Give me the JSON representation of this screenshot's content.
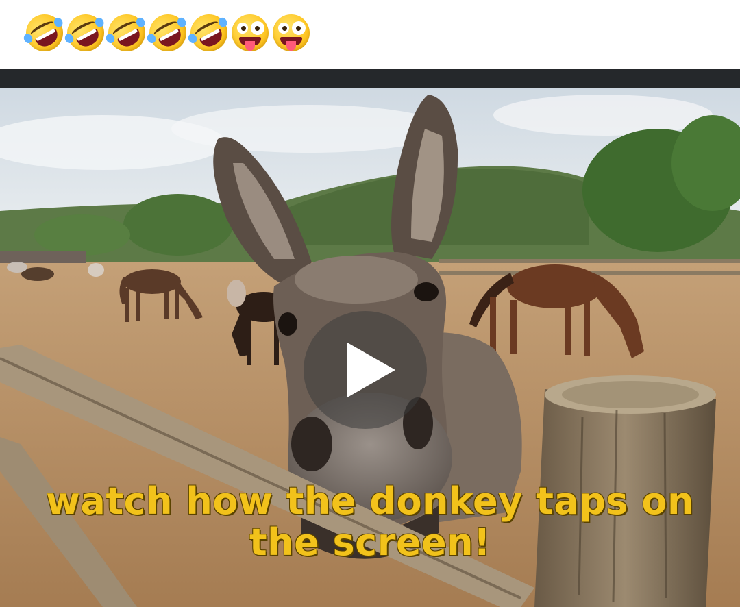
{
  "post": {
    "emojis": [
      {
        "type": "rolling-on-the-floor-laughing-icon"
      },
      {
        "type": "rolling-on-the-floor-laughing-icon"
      },
      {
        "type": "rolling-on-the-floor-laughing-icon"
      },
      {
        "type": "rolling-on-the-floor-laughing-icon"
      },
      {
        "type": "rolling-on-the-floor-laughing-icon"
      },
      {
        "type": "zany-face-icon"
      },
      {
        "type": "zany-face-icon"
      }
    ]
  },
  "video": {
    "caption_line1": "watch how the donkey taps on",
    "caption_line2": "the screen!",
    "play_icon": "play-icon"
  },
  "colors": {
    "caption": "#f2c21b",
    "bar": "#25282b",
    "sky": "#dfe6ec",
    "ground": "#b88f63"
  }
}
